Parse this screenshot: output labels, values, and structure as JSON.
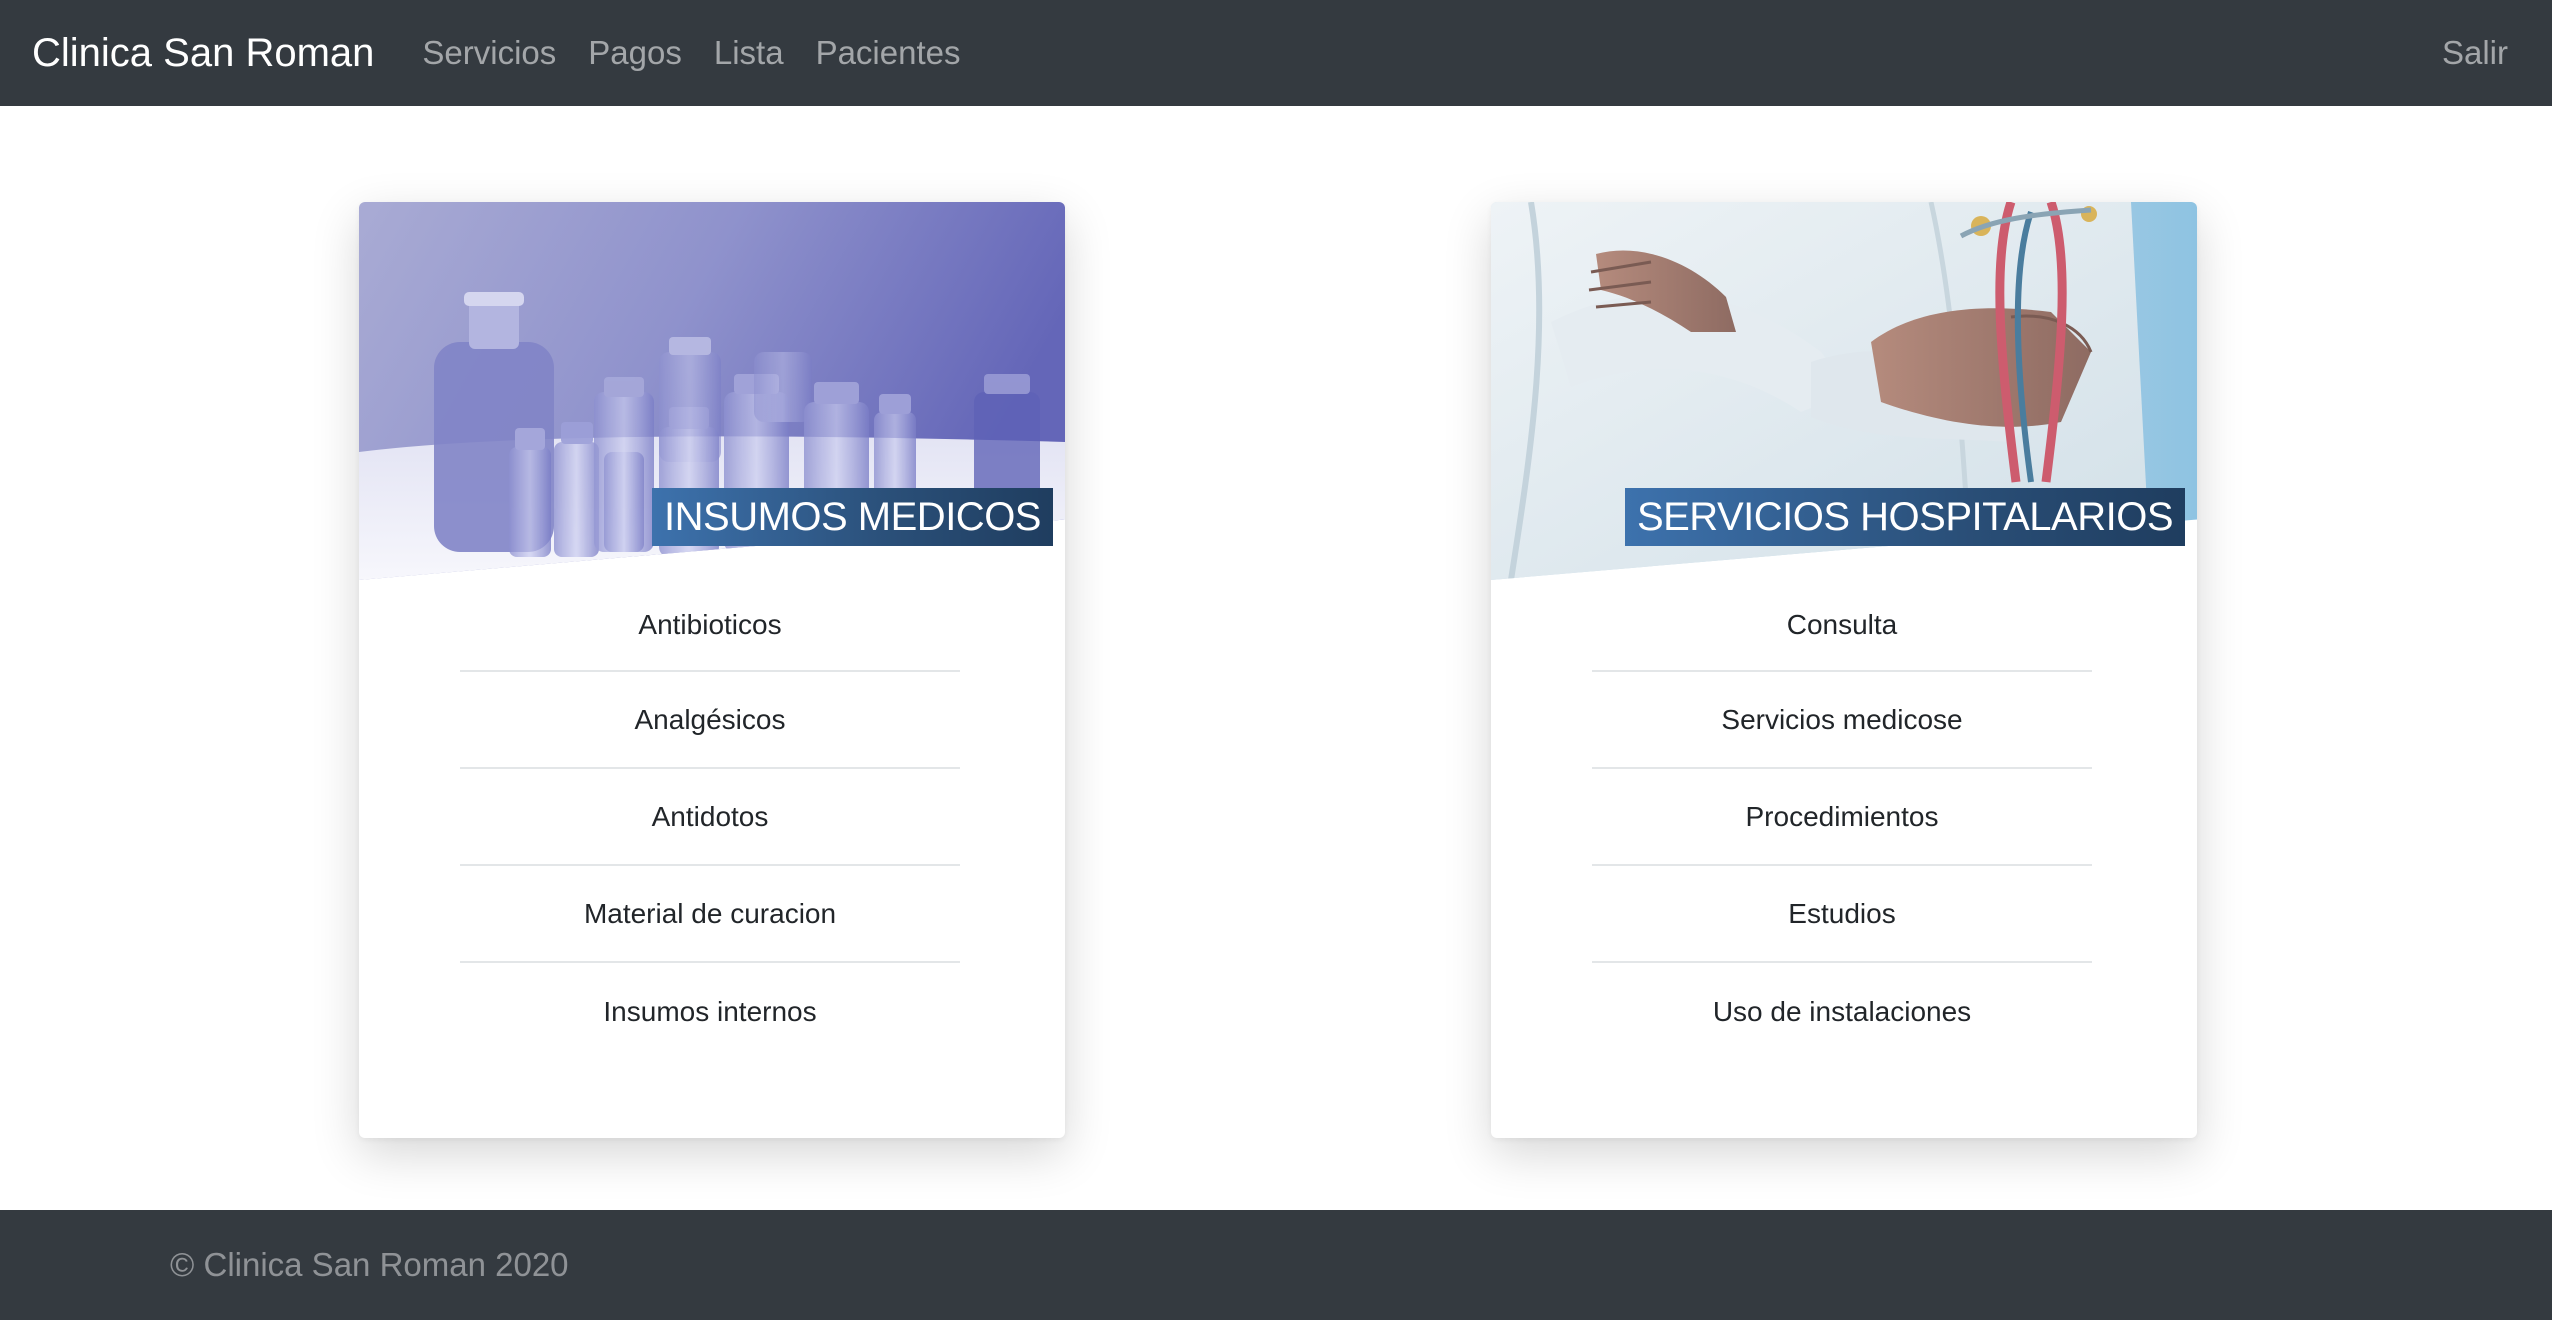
{
  "navbar": {
    "brand": "Clinica San Roman",
    "links": [
      "Servicios",
      "Pagos",
      "Lista",
      "Pacientes"
    ],
    "logout": "Salir",
    "background": "#343a40"
  },
  "cards": [
    {
      "title": "INSUMOS MEDICOS",
      "image": "medicine-vials-image",
      "items": [
        "Antibioticos",
        "Analgésicos",
        "Antidotos",
        "Material de curacion",
        "Insumos internos"
      ]
    },
    {
      "title": "SERVICIOS HOSPITALARIOS",
      "image": "doctor-stethoscope-image",
      "items": [
        "Consulta",
        "Servicios medicose",
        "Procedimientos",
        "Estudios",
        "Uso de instalaciones"
      ]
    }
  ],
  "footer": {
    "text": "© Clinica San Roman 2020"
  }
}
